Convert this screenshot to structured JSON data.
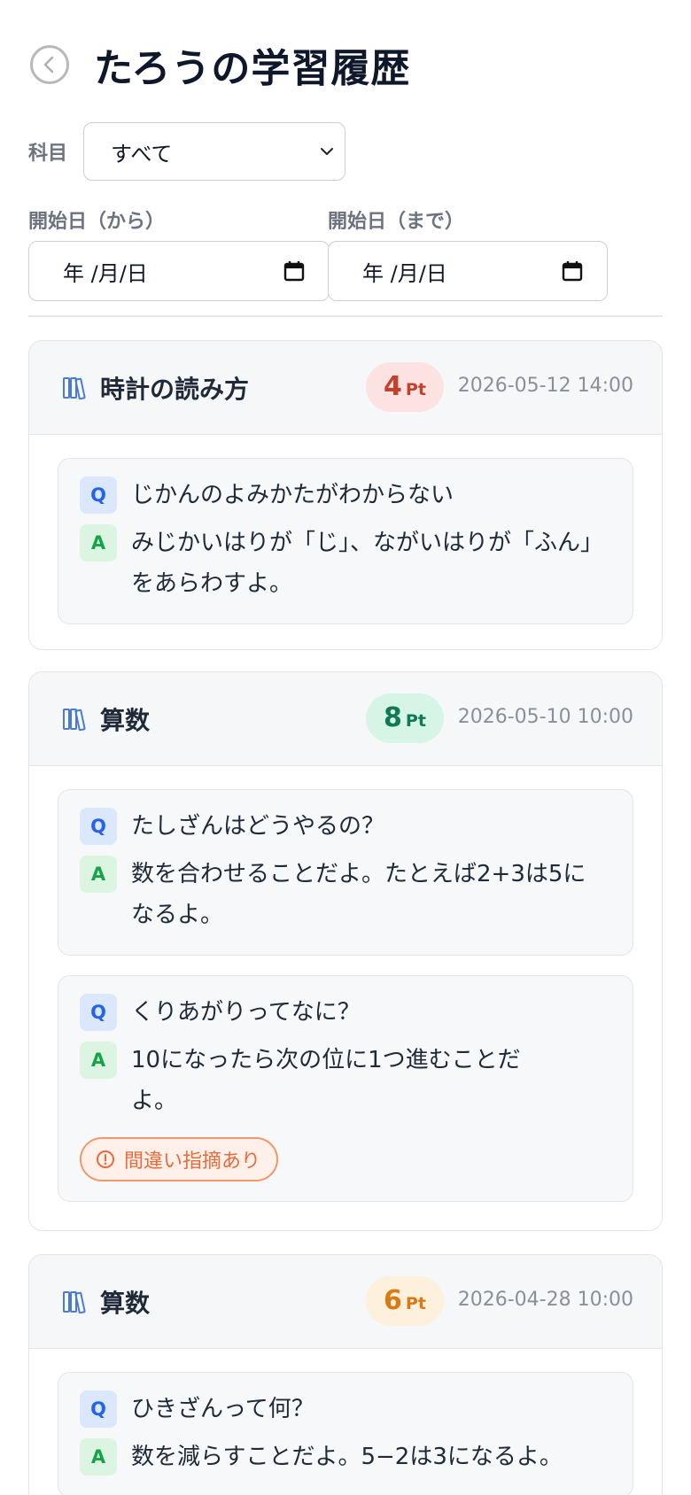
{
  "header": {
    "title": "たろうの学習履歴"
  },
  "filters": {
    "subject_label": "科目",
    "subject_value": "すべて",
    "start_from_label": "開始日（から）",
    "start_to_label": "開始日（まで）",
    "date_placeholder": "年 /月/日"
  },
  "cards": [
    {
      "title": "時計の読み方",
      "points": "4",
      "points_unit": "Pt",
      "date": "2026-05-12 14:00",
      "badge_color": "#c2412d",
      "badge_bg": "#fde2e2",
      "qa": [
        {
          "q": "じかんのよみかたがわからない",
          "a": "みじかいはりが「じ」、ながいはりが「ふん」をあらわすよ。"
        }
      ]
    },
    {
      "title": "算数",
      "points": "8",
      "points_unit": "Pt",
      "date": "2026-05-10 10:00",
      "badge_color": "#0f7a55",
      "badge_bg": "#d7f5e6",
      "qa": [
        {
          "q": "たしざんはどうやるの？",
          "a": "数を合わせることだよ。たとえば2+3は5になるよ。"
        },
        {
          "q": "くりあがりってなに？",
          "a": "10になったら次の位に1つ進むことだよ。",
          "warning": "間違い指摘あり"
        }
      ]
    },
    {
      "title": "算数",
      "points": "6",
      "points_unit": "Pt",
      "date": "2026-04-28 10:00",
      "badge_color": "#d97a14",
      "badge_bg": "#fdf0dc",
      "qa": [
        {
          "q": "ひきざんって何？",
          "a": "数を減らすことだよ。5−2は3になるよ。"
        }
      ]
    }
  ],
  "labels": {
    "q_tag": "Q",
    "a_tag": "A"
  },
  "colors": {
    "q": "#2563eb",
    "a": "#16a34a",
    "warning": "#ea6b3b"
  }
}
